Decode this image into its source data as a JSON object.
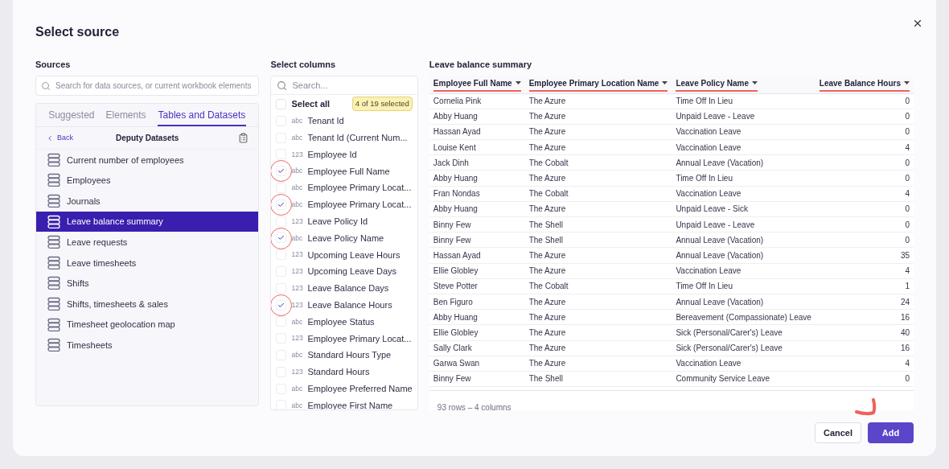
{
  "dialog": {
    "title": "Select source"
  },
  "sources": {
    "heading": "Sources",
    "search": {
      "placeholder": "Search for data sources, or current workbook elements"
    },
    "tabs": [
      {
        "label": "Suggested",
        "selected": false
      },
      {
        "label": "Elements",
        "selected": false
      },
      {
        "label": "Tables and Datasets",
        "selected": true
      }
    ],
    "back": "Back",
    "folder": "Deputy Datasets",
    "items": [
      {
        "label": "Current number of employees",
        "selected": false
      },
      {
        "label": "Employees",
        "selected": false
      },
      {
        "label": "Journals",
        "selected": false
      },
      {
        "label": "Leave balance summary",
        "selected": true
      },
      {
        "label": "Leave requests",
        "selected": false
      },
      {
        "label": "Leave timesheets",
        "selected": false
      },
      {
        "label": "Shifts",
        "selected": false
      },
      {
        "label": "Shifts, timesheets & sales",
        "selected": false
      },
      {
        "label": "Timesheet geolocation map",
        "selected": false
      },
      {
        "label": "Timesheets",
        "selected": false
      }
    ]
  },
  "columns": {
    "heading": "Select columns",
    "search": {
      "placeholder": "Search..."
    },
    "select_all": {
      "label": "Select all",
      "checked": false
    },
    "count": "4 of 19 selected",
    "items": [
      {
        "type": "abc",
        "label": "Tenant Id",
        "checked": false,
        "circled": false
      },
      {
        "type": "abc",
        "label": "Tenant Id (Current Num...",
        "checked": false,
        "circled": false
      },
      {
        "type": "123",
        "label": "Employee Id",
        "checked": false,
        "circled": false
      },
      {
        "type": "abc",
        "label": "Employee Full Name",
        "checked": true,
        "circled": true
      },
      {
        "type": "abc",
        "label": "Employee Primary Locat...",
        "checked": false,
        "circled": false
      },
      {
        "type": "abc",
        "label": "Employee Primary Locat...",
        "checked": true,
        "circled": true
      },
      {
        "type": "123",
        "label": "Leave Policy Id",
        "checked": false,
        "circled": false
      },
      {
        "type": "abc",
        "label": "Leave Policy Name",
        "checked": true,
        "circled": true
      },
      {
        "type": "123",
        "label": "Upcoming Leave Hours",
        "checked": false,
        "circled": false
      },
      {
        "type": "123",
        "label": "Upcoming Leave Days",
        "checked": false,
        "circled": false
      },
      {
        "type": "123",
        "label": "Leave Balance Days",
        "checked": false,
        "circled": false
      },
      {
        "type": "123",
        "label": "Leave Balance Hours",
        "checked": true,
        "circled": true
      },
      {
        "type": "abc",
        "label": "Employee Status",
        "checked": false,
        "circled": false
      },
      {
        "type": "123",
        "label": "Employee Primary Locat...",
        "checked": false,
        "circled": false
      },
      {
        "type": "abc",
        "label": "Standard Hours Type",
        "checked": false,
        "circled": false
      },
      {
        "type": "123",
        "label": "Standard Hours",
        "checked": false,
        "circled": false
      },
      {
        "type": "abc",
        "label": "Employee Preferred Name",
        "checked": false,
        "circled": false
      },
      {
        "type": "abc",
        "label": "Employee First Name",
        "checked": false,
        "circled": false
      }
    ]
  },
  "preview": {
    "heading": "Leave balance summary",
    "table": {
      "columns": [
        {
          "label": "Employee Full Name",
          "numeric": false,
          "underlined": true
        },
        {
          "label": "Employee Primary Location Name",
          "numeric": false,
          "underlined": true
        },
        {
          "label": "Leave Policy Name",
          "numeric": false,
          "underlined": true
        },
        {
          "label": "Leave Balance Hours",
          "numeric": true,
          "underlined": true
        }
      ],
      "rows": [
        [
          "Cornelia Pink",
          "The Azure",
          "Time Off In Lieu",
          "0"
        ],
        [
          "Abby Huang",
          "The Azure",
          "Unpaid Leave - Leave",
          "0"
        ],
        [
          "Hassan Ayad",
          "The Azure",
          "Vaccination Leave",
          "0"
        ],
        [
          "Louise Kent",
          "The Azure",
          "Vaccination Leave",
          "4"
        ],
        [
          "Jack Dinh",
          "The Cobalt",
          "Annual Leave (Vacation)",
          "0"
        ],
        [
          "Abby Huang",
          "The Azure",
          "Time Off In Lieu",
          "0"
        ],
        [
          "Fran Nondas",
          "The Cobalt",
          "Vaccination Leave",
          "4"
        ],
        [
          "Abby Huang",
          "The Azure",
          "Unpaid Leave - Sick",
          "0"
        ],
        [
          "Binny Few",
          "The Shell",
          "Unpaid Leave - Leave",
          "0"
        ],
        [
          "Binny Few",
          "The Shell",
          "Annual Leave (Vacation)",
          "0"
        ],
        [
          "Hassan Ayad",
          "The Azure",
          "Annual Leave (Vacation)",
          "35"
        ],
        [
          "Ellie Globley",
          "The Azure",
          "Vaccination Leave",
          "4"
        ],
        [
          "Steve Potter",
          "The Cobalt",
          "Time Off In Lieu",
          "1"
        ],
        [
          "Ben Figuro",
          "The Azure",
          "Annual Leave (Vacation)",
          "24"
        ],
        [
          "Abby Huang",
          "The Azure",
          "Bereavement (Compassionate) Leave",
          "16"
        ],
        [
          "Ellie Globley",
          "The Azure",
          "Sick (Personal/Carer's) Leave",
          "40"
        ],
        [
          "Sally Clark",
          "The Azure",
          "Sick (Personal/Carer's) Leave",
          "16"
        ],
        [
          "Garwa Swan",
          "The Azure",
          "Vaccination Leave",
          "4"
        ],
        [
          "Binny Few",
          "The Shell",
          "Community Service Leave",
          "0"
        ]
      ]
    },
    "footer": "93 rows – 4 columns"
  },
  "buttons": [
    {
      "label": "Cancel",
      "kind": "secondary"
    },
    {
      "label": "Add",
      "kind": "primary"
    }
  ]
}
